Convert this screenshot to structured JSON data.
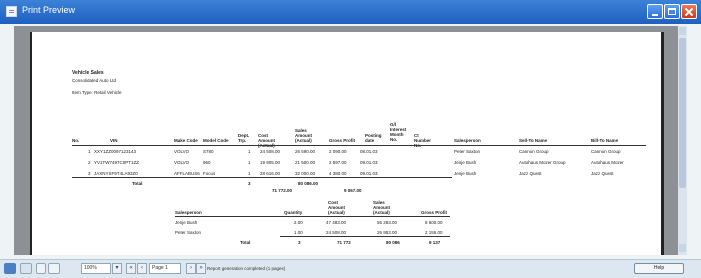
{
  "window": {
    "title": "Print Preview"
  },
  "report": {
    "title": "Vehicle Sales",
    "company": "Consolidated Auto Ltd",
    "filter": "Item Type: Retail Vehicle",
    "columns": [
      "No.",
      "VIN",
      "Make Code",
      "Model Code",
      "Dept. Trp.",
      "Cost Amount (Actual)",
      "Sales Amount (Actual)",
      "Gross Profit",
      "Posting date",
      "G/l Interest Month No.",
      "Ct Number No.",
      "Salesperson",
      "Sell-To Name",
      "Bill-To Name"
    ],
    "rows": [
      [
        "1",
        "XXY1ZZ0097123143",
        "VOLVO",
        "S780",
        "1",
        "24 508.00",
        "26 590.00",
        "2 090.00",
        "08.01.03",
        "",
        "",
        "Peter Saxton",
        "Cannon Group",
        "Cannon Group"
      ],
      [
        "2",
        "YV1TW7497C0PT1ZZ",
        "VOLVO",
        "960",
        "1",
        "19 905.00",
        "21 500.00",
        "2 597.00",
        "09.01.03",
        "",
        "",
        "Jenje Bush",
        "Autohaus Mozer Group",
        "Autohaus Mozer"
      ],
      [
        "3",
        "JAXNYSF9T4LA93Z0",
        "AFFLABUS6",
        "Focus",
        "1",
        "28 616.00",
        "32 000.00",
        "4 380.00",
        "09.01.03",
        "",
        "",
        "Jenje Bush",
        "Jazz Quest",
        "Jazz Quest"
      ]
    ],
    "total": {
      "label": "Total",
      "qty": "3",
      "cost": "71 772.00",
      "sales": "80 086.00",
      "profit": "9 067.00"
    },
    "summary": {
      "columns": [
        "Salesperson",
        "Quantity",
        "Cost Amount (Actual)",
        "Sales Amount (Actual)",
        "Gross Profit"
      ],
      "rows": [
        [
          "Jenje Bush",
          "2.00",
          "47 483.00",
          "55 283.00",
          "8 600.00"
        ],
        [
          "Peter Saxton",
          "1.00",
          "24 508.00",
          "26 953.00",
          "2 155.00"
        ]
      ],
      "total": [
        "Total",
        "3",
        "71 772",
        "80 086",
        "9 137"
      ]
    }
  },
  "statusbar": {
    "zoom": "100%",
    "page": "Page 1",
    "status": "Report generation completed (1 pages)",
    "help": "Help"
  }
}
